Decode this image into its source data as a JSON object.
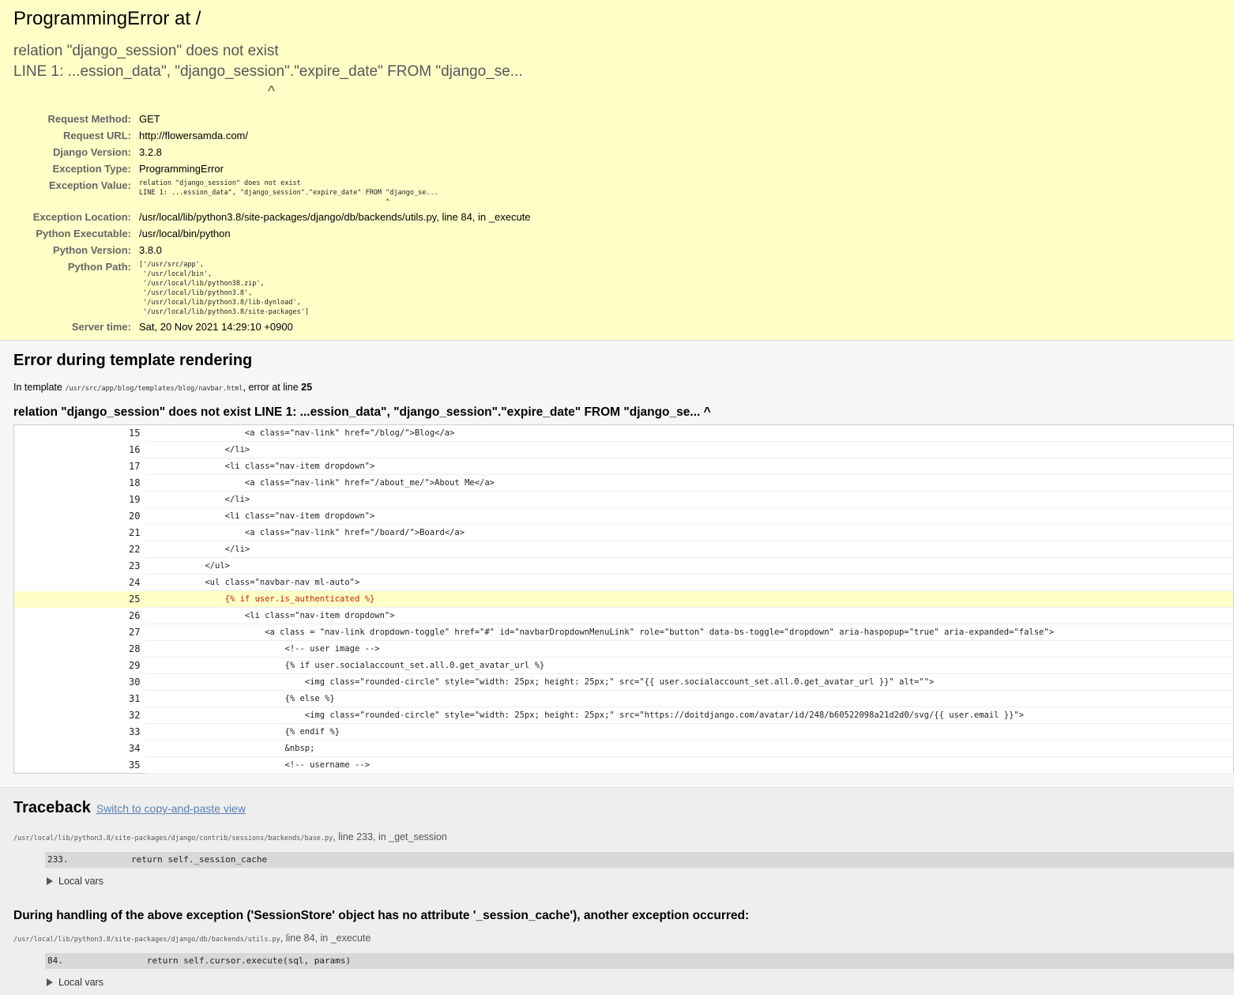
{
  "summary": {
    "title": "ProgrammingError at /",
    "exception_value": "relation \"django_session\" does not exist\nLINE 1: ...ession_data\", \"django_session\".\"expire_date\" FROM \"django_se...\n                                                             ^",
    "meta": [
      {
        "label": "Request Method:",
        "value": "GET"
      },
      {
        "label": "Request URL:",
        "value": "http://flowersamda.com/"
      },
      {
        "label": "Django Version:",
        "value": "3.2.8"
      },
      {
        "label": "Exception Type:",
        "value": "ProgrammingError"
      },
      {
        "label": "Exception Value:",
        "value": "relation \"django_session\" does not exist\nLINE 1: ...ession_data\", \"django_session\".\"expire_date\" FROM \"django_se...\n                                                             ^"
      },
      {
        "label": "Exception Location:",
        "value": "/usr/local/lib/python3.8/site-packages/django/db/backends/utils.py, line 84, in _execute"
      },
      {
        "label": "Python Executable:",
        "value": "/usr/local/bin/python"
      },
      {
        "label": "Python Version:",
        "value": "3.8.0"
      },
      {
        "label": "Python Path:",
        "value": "['/usr/src/app',\n '/usr/local/bin',\n '/usr/local/lib/python38.zip',\n '/usr/local/lib/python3.8',\n '/usr/local/lib/python3.8/lib-dynload',\n '/usr/local/lib/python3.8/site-packages']"
      },
      {
        "label": "Server time:",
        "value": "Sat, 20 Nov 2021 14:29:10 +0900"
      }
    ]
  },
  "template": {
    "heading": "Error during template rendering",
    "in_template_prefix": "In template ",
    "template_path": "/usr/src/app/blog/templates/blog/navbar.html",
    "error_at_text": ", error at line ",
    "error_line": "25",
    "message": "relation \"django_session\" does not exist LINE 1: ...ession_data\", \"django_session\".\"expire_date\" FROM \"django_se... ^",
    "highlight_line": 25,
    "lines": [
      {
        "num": "15",
        "code": "                    <a class=\"nav-link\" href=\"/blog/\">Blog</a>"
      },
      {
        "num": "16",
        "code": "                </li>"
      },
      {
        "num": "17",
        "code": "                <li class=\"nav-item dropdown\">"
      },
      {
        "num": "18",
        "code": "                    <a class=\"nav-link\" href=\"/about_me/\">About Me</a>"
      },
      {
        "num": "19",
        "code": "                </li>"
      },
      {
        "num": "20",
        "code": "                <li class=\"nav-item dropdown\">"
      },
      {
        "num": "21",
        "code": "                    <a class=\"nav-link\" href=\"/board/\">Board</a>"
      },
      {
        "num": "22",
        "code": "                </li>"
      },
      {
        "num": "23",
        "code": "            </ul>"
      },
      {
        "num": "24",
        "code": "            <ul class=\"navbar-nav ml-auto\">"
      },
      {
        "num": "25",
        "code": "                {% if user.is_authenticated %}"
      },
      {
        "num": "26",
        "code": "                    <li class=\"nav-item dropdown\">"
      },
      {
        "num": "27",
        "code": "                        <a class = \"nav-link dropdown-toggle\" href=\"#\" id=\"navbarDropdownMenuLink\" role=\"button\" data-bs-toggle=\"dropdown\" aria-haspopup=\"true\" aria-expanded=\"false\">"
      },
      {
        "num": "28",
        "code": "                            <!-- user image -->"
      },
      {
        "num": "29",
        "code": "                            {% if user.socialaccount_set.all.0.get_avatar_url %}"
      },
      {
        "num": "30",
        "code": "                                <img class=\"rounded-circle\" style=\"width: 25px; height: 25px;\" src=\"{{ user.socialaccount_set.all.0.get_avatar_url }}\" alt=\"\">"
      },
      {
        "num": "31",
        "code": "                            {% else %}"
      },
      {
        "num": "32",
        "code": "                                <img class=\"rounded-circle\" style=\"width: 25px; height: 25px;\" src=\"https://doitdjango.com/avatar/id/248/b60522098a21d2d0/svg/{{ user.email }}\">"
      },
      {
        "num": "33",
        "code": "                            {% endif %}"
      },
      {
        "num": "34",
        "code": "                            &nbsp;"
      },
      {
        "num": "35",
        "code": "                            <!-- username -->"
      }
    ]
  },
  "traceback": {
    "heading": "Traceback",
    "switch_link": "Switch to copy-and-paste view",
    "frame1": {
      "file": "/usr/local/lib/python3.8/site-packages/django/contrib/sessions/backends/base.py",
      "info": ", line 233, in _get_session",
      "context": "233.            return self._session_cache",
      "local_vars": "Local vars"
    },
    "chained_message": "During handling of the above exception ('SessionStore' object has no attribute '_session_cache'), another exception occurred:",
    "frame2": {
      "file": "/usr/local/lib/python3.8/site-packages/django/db/backends/utils.py",
      "info": ", line 84, in _execute",
      "context": "84.                return self.cursor.execute(sql, params)",
      "local_vars": "Local vars"
    }
  }
}
